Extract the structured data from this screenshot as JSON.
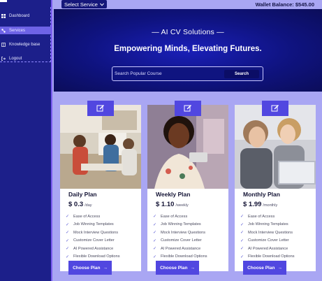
{
  "topbar": {
    "select_service_label": "Select Service",
    "wallet_balance": "Wallet Balance: $545.00"
  },
  "sidebar": {
    "items": [
      {
        "label": "Dashboard",
        "icon": "grid-icon"
      },
      {
        "label": "Services",
        "icon": "cog-network-icon"
      },
      {
        "label": "Knowledge base",
        "icon": "book-icon"
      },
      {
        "label": "Logout",
        "icon": "logout-icon"
      }
    ],
    "active_index": 1
  },
  "hero": {
    "title": "— AI CV Solutions —",
    "subtitle": "Empowering Minds, Elevating Futures.",
    "search_placeholder": "Search Popular Course",
    "search_button": "Search"
  },
  "plans": [
    {
      "name": "Daily Plan",
      "price": "$ 0.3",
      "unit": "/day",
      "features": [
        "Ease of Access",
        "Job Winning Templates",
        "Mock Interview Questions",
        "Customize Cover Letter",
        "AI Powered Assistance",
        "Flexible Download Options"
      ],
      "button": "Choose Plan"
    },
    {
      "name": "Weekly Plan",
      "price": "$ 1.10",
      "unit": "/weekly",
      "features": [
        "Ease of Access",
        "Job Winning Templates",
        "Mock Interview Questions",
        "Customize Cover Letter",
        "AI Powered Assistance",
        "Flexible Download Options"
      ],
      "button": "Choose Plan"
    },
    {
      "name": "Monthly Plan",
      "price": "$ 1.99",
      "unit": "/monthly",
      "features": [
        "Ease of Access",
        "Job Winning Templates",
        "Mock Interview Questions",
        "Customize Cover Letter",
        "AI Powered Assistance",
        "Flexible Download Options"
      ],
      "button": "Choose Plan"
    }
  ],
  "colors": {
    "sidebar_bg": "#1c1f8a",
    "page_bg": "#a9a6f3",
    "accent": "#5147e0",
    "hero_bg": "#0f1380"
  }
}
